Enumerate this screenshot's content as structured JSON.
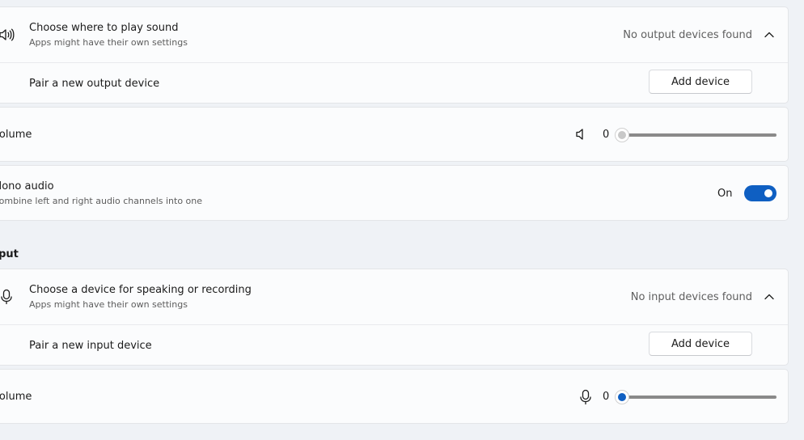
{
  "output": {
    "device_row": {
      "title": "Choose where to play sound",
      "subtitle": "Apps might have their own settings",
      "status": "No output devices found",
      "icon": "speaker-icon",
      "chevron": "chevron-up-icon"
    },
    "pair_row": {
      "label": "Pair a new output device",
      "button": "Add device"
    },
    "volume": {
      "label": "Volume",
      "value": "0",
      "level": 0,
      "icon": "speaker-muted-icon"
    },
    "mono": {
      "title": "Mono audio",
      "subtitle": "Combine left and right audio channels into one",
      "state_label": "On",
      "enabled": true
    }
  },
  "input": {
    "section_header": "Input",
    "device_row": {
      "title": "Choose a device for speaking or recording",
      "subtitle": "Apps might have their own settings",
      "status": "No input devices found",
      "icon": "microphone-icon",
      "chevron": "chevron-up-icon"
    },
    "pair_row": {
      "label": "Pair a new input device",
      "button": "Add device"
    },
    "volume": {
      "label": "Volume",
      "value": "0",
      "level": 0,
      "icon": "microphone-icon"
    }
  },
  "colors": {
    "accent": "#0f5fc2",
    "background": "#eff2f6",
    "card": "#fbfcfd"
  }
}
